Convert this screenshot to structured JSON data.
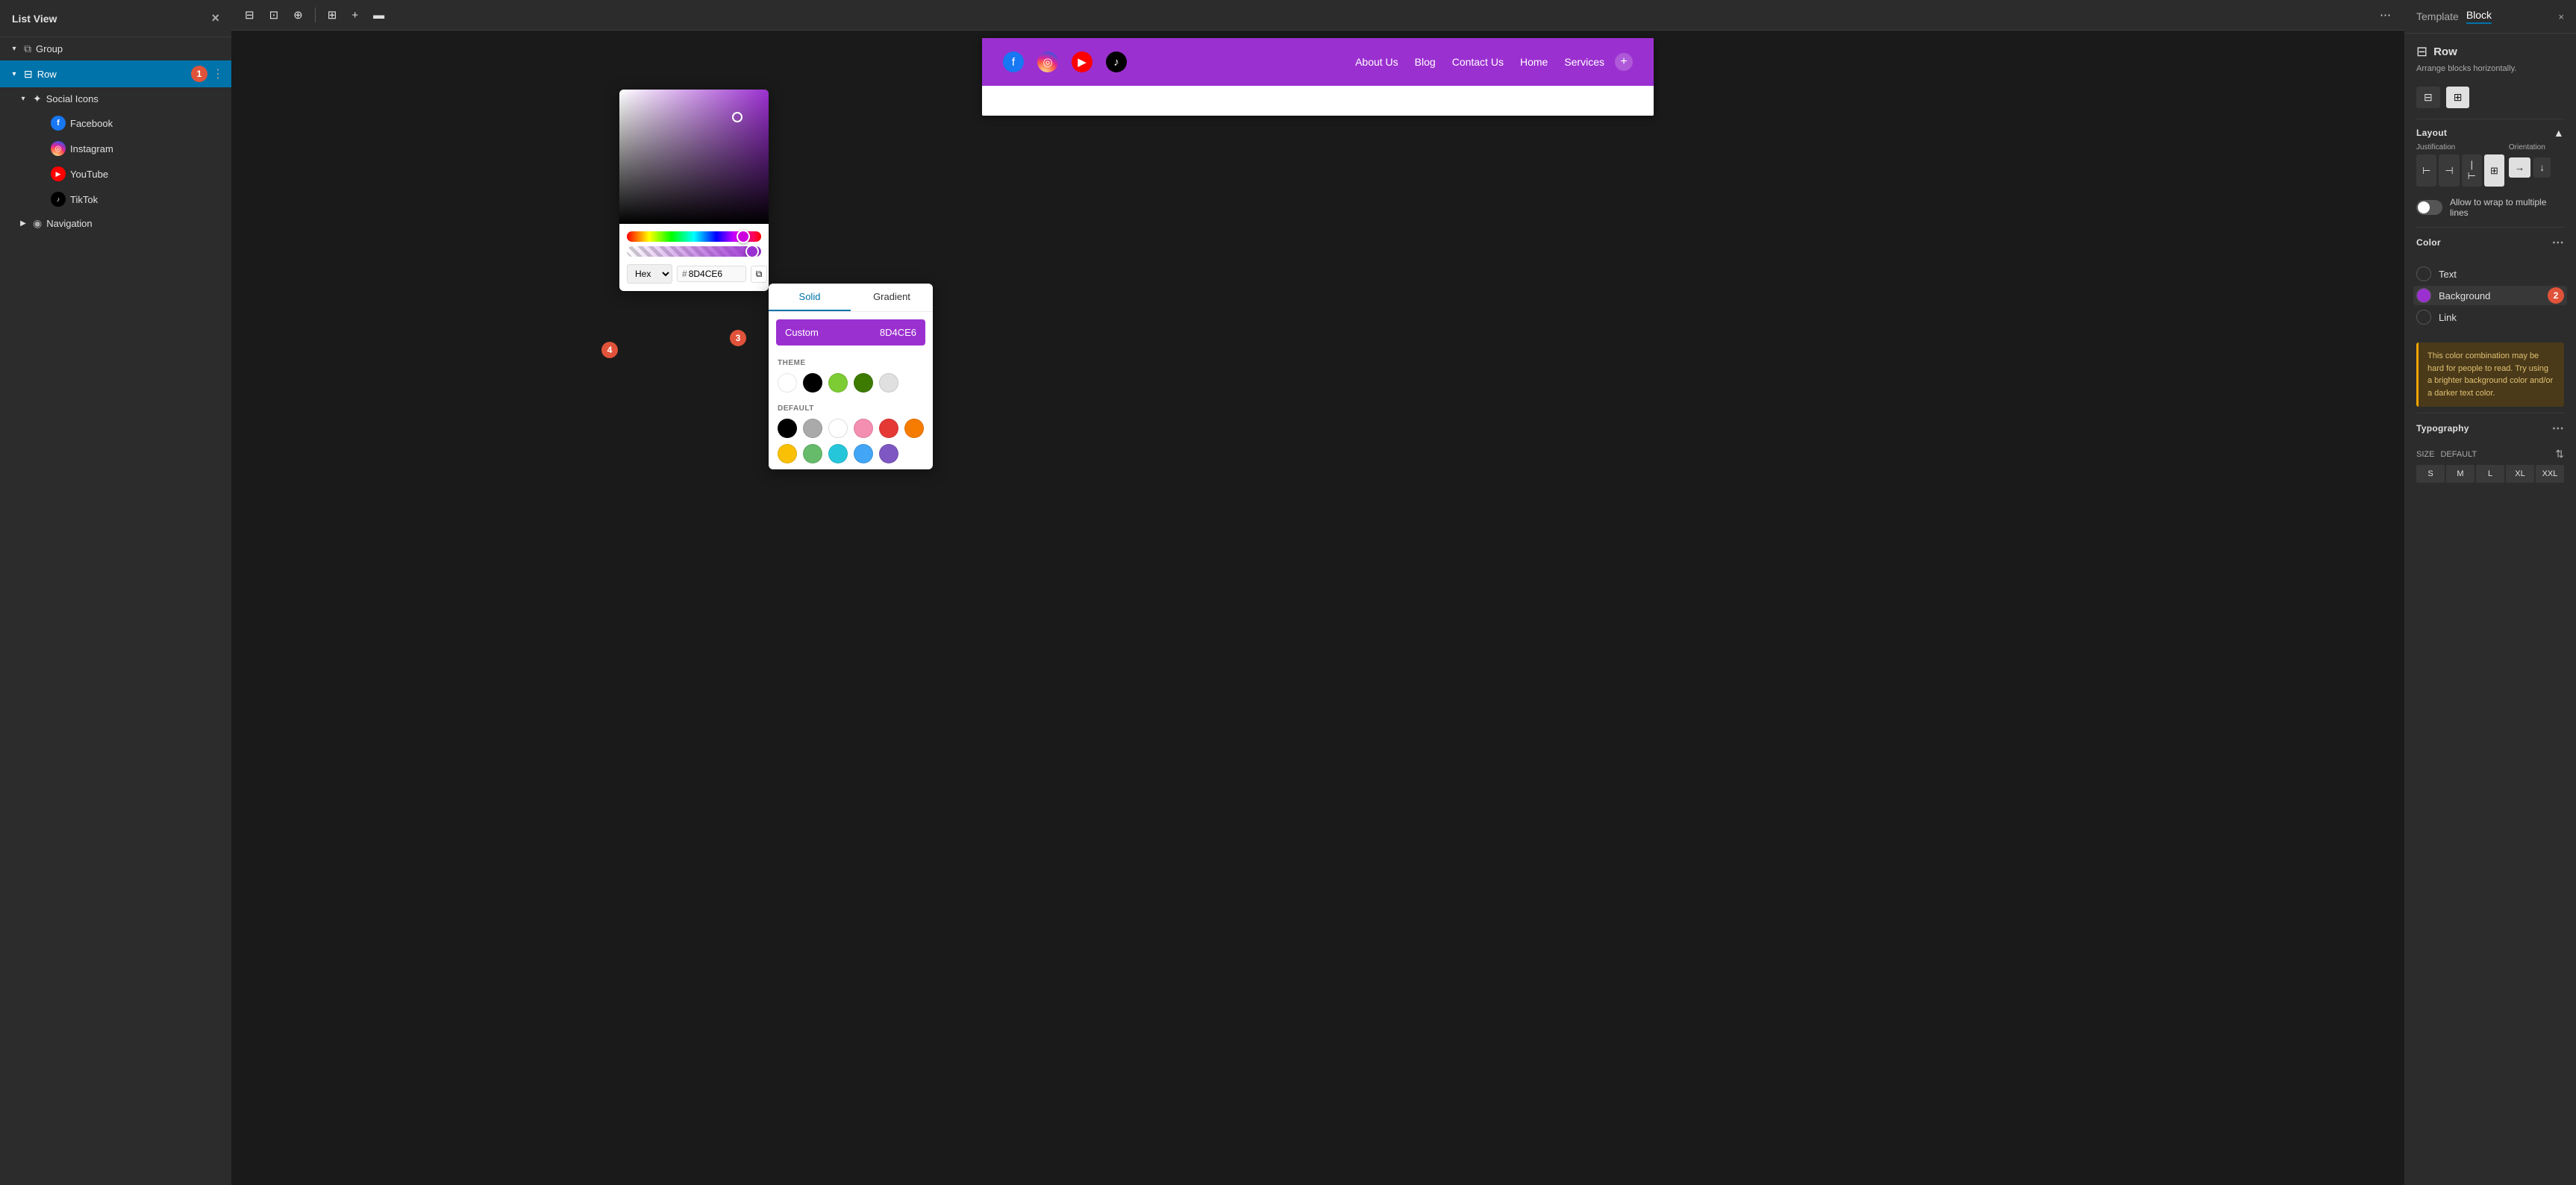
{
  "leftPanel": {
    "title": "List View",
    "close_label": "×",
    "tree": [
      {
        "id": "group",
        "label": "Group",
        "icon": "⊞",
        "indent": 0,
        "chevron": "▾",
        "type": "group"
      },
      {
        "id": "row",
        "label": "Row",
        "icon": "⊟",
        "indent": 0,
        "chevron": "▾",
        "badge": "1",
        "type": "row",
        "selected": true
      },
      {
        "id": "social-icons",
        "label": "Social Icons",
        "icon": "⋈",
        "indent": 1,
        "chevron": "▾",
        "type": "social"
      },
      {
        "id": "facebook",
        "label": "Facebook",
        "icon": "f",
        "indent": 2,
        "type": "facebook"
      },
      {
        "id": "instagram",
        "label": "Instagram",
        "icon": "◎",
        "indent": 2,
        "type": "instagram"
      },
      {
        "id": "youtube",
        "label": "YouTube",
        "icon": "▶",
        "indent": 2,
        "type": "youtube"
      },
      {
        "id": "tiktok",
        "label": "TikTok",
        "icon": "♪",
        "indent": 2,
        "type": "tiktok"
      },
      {
        "id": "navigation",
        "label": "Navigation",
        "icon": "◉",
        "indent": 1,
        "chevron": "▶",
        "type": "navigation"
      }
    ]
  },
  "canvas": {
    "toolbar": {
      "buttons": [
        "⊟",
        "⊡",
        "⊕",
        "⇅",
        "⊞",
        "+",
        "▬",
        "⋯"
      ]
    },
    "header": {
      "socialIcons": [
        "f",
        "◎",
        "▶",
        "♪"
      ],
      "navItems": [
        "About Us",
        "Blog",
        "Contact Us",
        "Home",
        "Services"
      ]
    }
  },
  "colorPicker": {
    "hexLabel": "Hex",
    "hexValue": "8D4CE6",
    "copyIcon": "⧉"
  },
  "solidGradient": {
    "tabs": [
      "Solid",
      "Gradient"
    ],
    "activeTab": "Solid",
    "customLabel": "Custom",
    "customValue": "8D4CE6",
    "themeLabel": "THEME",
    "defaultLabel": "DEFAULT",
    "themeColors": [
      "#ffffff",
      "#000000",
      "#7dcc33",
      "#3d7a00",
      "#e0e0e0"
    ],
    "defaultColors": [
      "#000000",
      "#aaaaaa",
      "#ffffff",
      "#f48fb1",
      "#e53935",
      "#f57c00",
      "#f9c006",
      "#66bb6a",
      "#26c6da",
      "#42a5f5",
      "#7e57c2"
    ],
    "badge": "3"
  },
  "rightPanel": {
    "tabs": [
      "Template",
      "Block"
    ],
    "activeTab": "Block",
    "close_label": "×",
    "blockTitle": "Row",
    "blockDesc": "Arrange blocks horizontally.",
    "iconButtons": [
      "⊟",
      "⊞"
    ],
    "layout": {
      "title": "Layout",
      "justification": {
        "label": "Justification",
        "buttons": [
          "⊢",
          "⊣",
          "⊤",
          "⊥",
          "⊞"
        ],
        "activeIndex": 3
      },
      "orientation": {
        "label": "Orientation",
        "buttons": [
          "→",
          "↓"
        ],
        "activeIndex": 0
      },
      "wrapLabel": "Allow to wrap to multiple lines"
    },
    "color": {
      "title": "Color",
      "textLabel": "Text",
      "backgroundLabel": "Background",
      "linkLabel": "Link",
      "activeColor": "#9b30d0",
      "warningText": "This color combination may be hard for people to read. Try using a brighter background color and/or a darker text color.",
      "badge": "2"
    },
    "typography": {
      "title": "Typography",
      "sizeLabel": "SIZE",
      "sizeDefault": "DEFAULT",
      "sizes": [
        "S",
        "M",
        "L",
        "XL",
        "XXL"
      ]
    }
  }
}
